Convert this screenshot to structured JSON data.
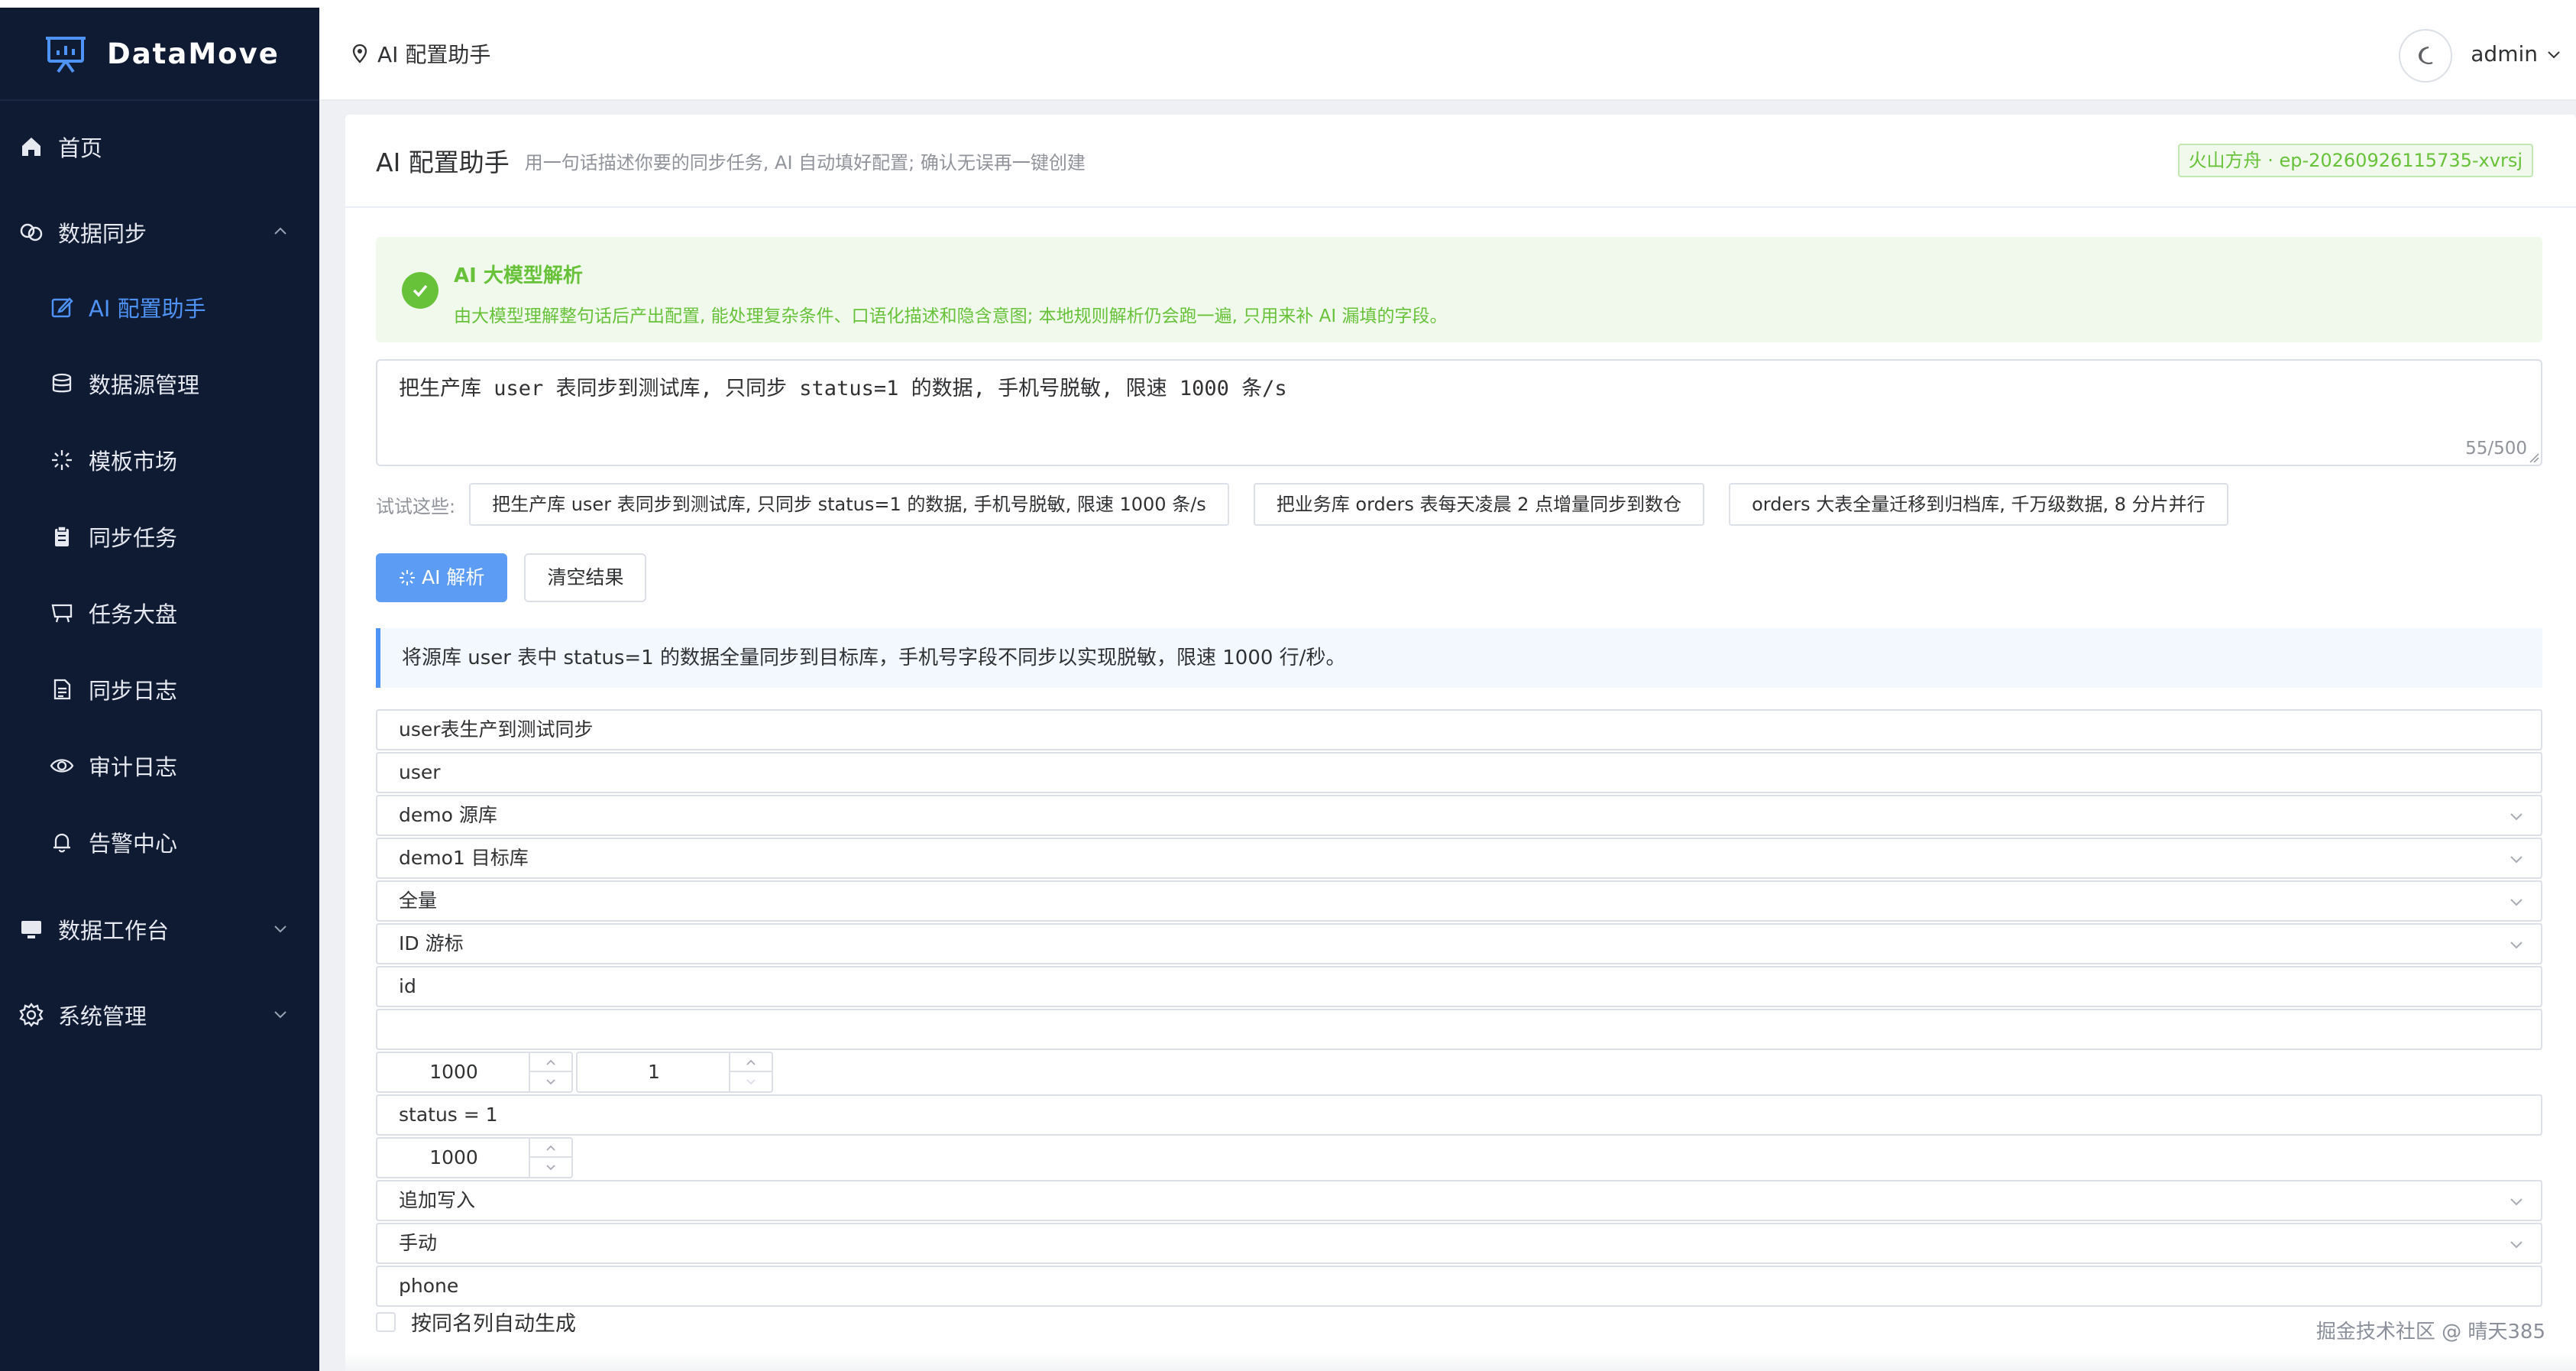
{
  "app": {
    "name": "DataMove"
  },
  "sidebar": {
    "items": [
      {
        "label": "首页",
        "icon": "home-icon"
      },
      {
        "label": "数据同步",
        "icon": "sync-icon",
        "expanded": true
      },
      {
        "label": "AI 配置助手",
        "icon": "edit-icon",
        "active": true
      },
      {
        "label": "数据源管理",
        "icon": "database-icon"
      },
      {
        "label": "模板市场",
        "icon": "spark-icon"
      },
      {
        "label": "同步任务",
        "icon": "clipboard-icon"
      },
      {
        "label": "任务大盘",
        "icon": "cart-icon"
      },
      {
        "label": "同步日志",
        "icon": "document-icon"
      },
      {
        "label": "审计日志",
        "icon": "eye-icon"
      },
      {
        "label": "告警中心",
        "icon": "bell-icon"
      },
      {
        "label": "数据工作台",
        "icon": "monitor-icon",
        "expanded": false
      },
      {
        "label": "系统管理",
        "icon": "gear-icon",
        "expanded": false
      }
    ]
  },
  "header": {
    "breadcrumb": "AI 配置助手",
    "user": "admin"
  },
  "card": {
    "title": "AI 配置助手",
    "desc": "用一句话描述你要的同步任务, AI 自动填好配置; 确认无误再一键创建",
    "model_tag": "火山方舟 · ep-20260926115735-xvrsj"
  },
  "alert": {
    "title": "AI 大模型解析",
    "desc": "由大模型理解整句话后产出配置, 能处理复杂条件、口语化描述和隐含意图; 本地规则解析仍会跑一遍, 只用来补 AI 漏填的字段。"
  },
  "prompt": {
    "value": "把生产库 user 表同步到测试库, 只同步 status=1 的数据, 手机号脱敏, 限速 1000 条/s",
    "count": "55/500"
  },
  "examples": {
    "label": "试试这些:",
    "items": [
      "把生产库 user 表同步到测试库, 只同步 status=1 的数据, 手机号脱敏, 限速 1000 条/s",
      "把业务库 orders 表每天凌晨 2 点增量同步到数仓",
      "orders 大表全量迁移到归档库, 千万级数据, 8 分片并行"
    ]
  },
  "buttons": {
    "parse": "AI 解析",
    "clear": "清空结果"
  },
  "summary": "将源库 user 表中 status=1 的数据全量同步到目标库，手机号字段不同步以实现脱敏，限速 1000 行/秒。",
  "form": {
    "task_name": "user表生产到测试同步",
    "table": "user",
    "source": "demo 源库",
    "target": "demo1 目标库",
    "sync_mode": "全量",
    "cursor_type": "ID 游标",
    "cursor_field": "id",
    "empty_field": "",
    "batch_size": "1000",
    "shards": "1",
    "where": "status = 1",
    "rate_limit": "1000",
    "write_mode": "追加写入",
    "trigger": "手动",
    "mask_field": "phone",
    "checkbox_label": "按同名列自动生成"
  },
  "watermark": "掘金技术社区 @ 晴天385",
  "colors": {
    "sidebar_bg": "#0f1a33",
    "accent": "#4e93f5",
    "success": "#67c23a"
  }
}
